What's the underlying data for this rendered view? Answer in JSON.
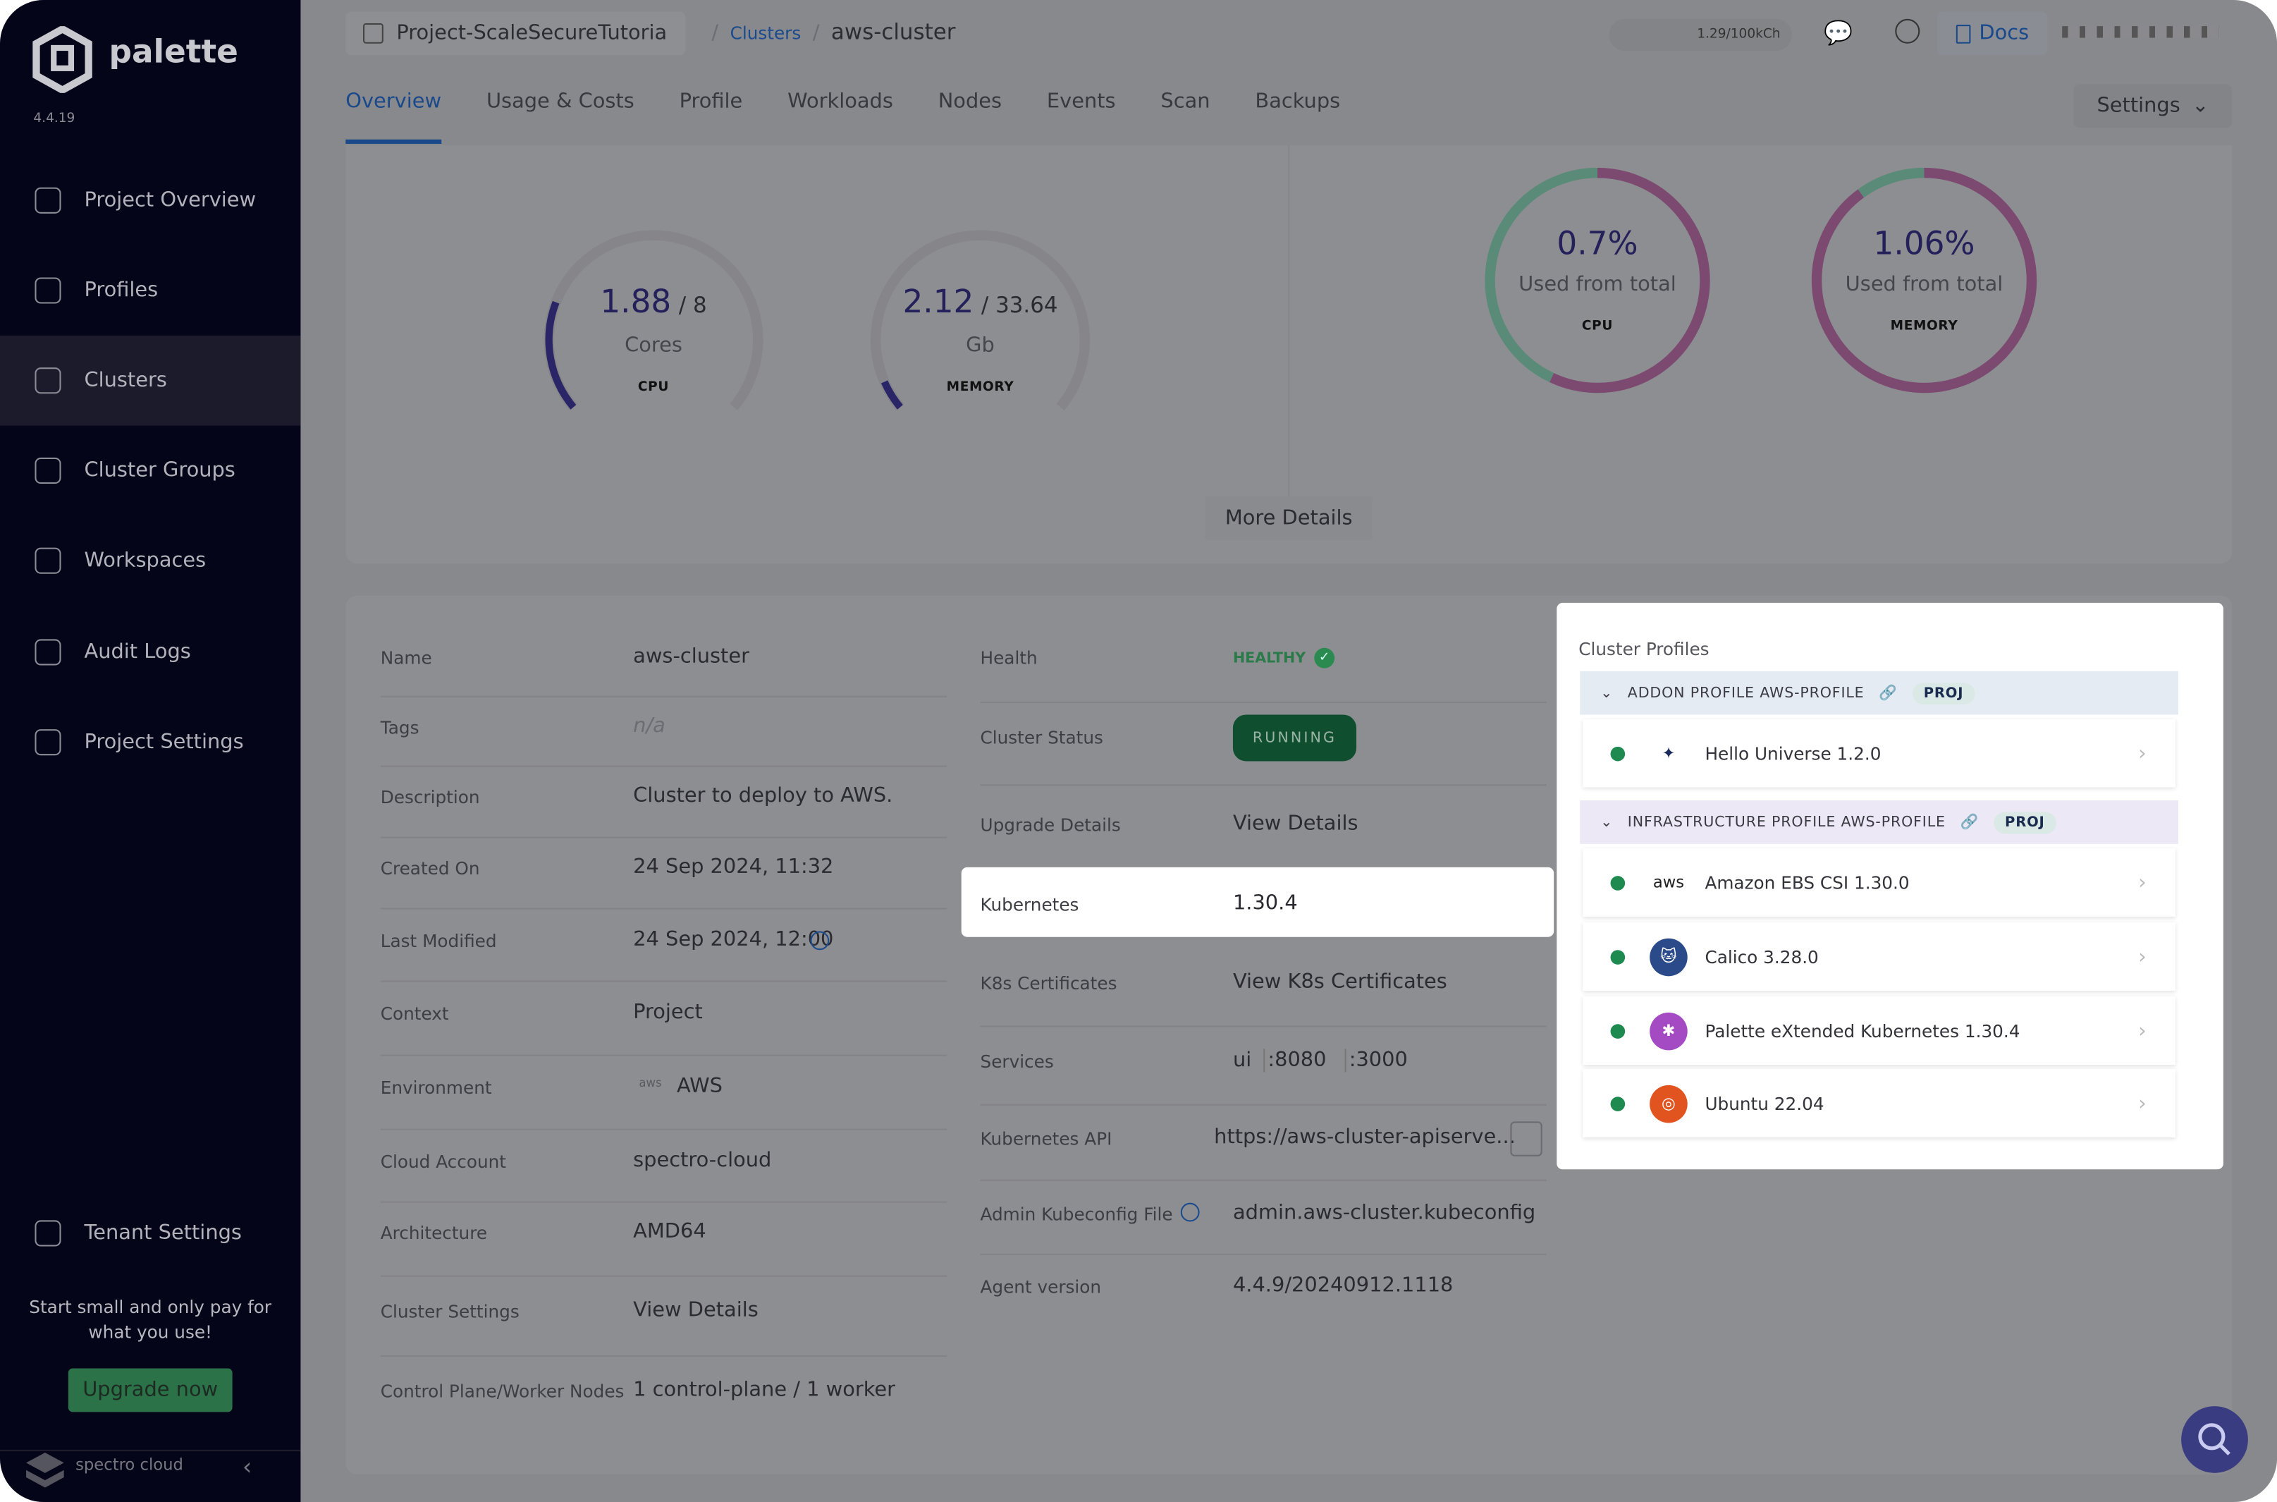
{
  "sidebar": {
    "brand": "palette",
    "version": "4.4.19",
    "items": [
      {
        "label": "Project Overview",
        "icon": "chart-icon"
      },
      {
        "label": "Profiles",
        "icon": "layers-icon"
      },
      {
        "label": "Clusters",
        "icon": "clusters-icon",
        "active": true
      },
      {
        "label": "Cluster Groups",
        "icon": "cluster-groups-icon"
      },
      {
        "label": "Workspaces",
        "icon": "workspaces-icon"
      },
      {
        "label": "Audit Logs",
        "icon": "audit-logs-icon"
      },
      {
        "label": "Project Settings",
        "icon": "gear-icon"
      }
    ],
    "tenant_settings": "Tenant Settings",
    "promo": "Start small and only pay for what you use!",
    "upgrade": "Upgrade now",
    "footer_brand": "spectro cloud"
  },
  "header": {
    "project": "Project-ScaleSecureTutoria",
    "crumb_clusters": "Clusters",
    "crumb_current": "aws-cluster",
    "usage": "1.29/100kCh",
    "docs": "Docs"
  },
  "tabs": [
    "Overview",
    "Usage & Costs",
    "Profile",
    "Workloads",
    "Nodes",
    "Events",
    "Scan",
    "Backups"
  ],
  "settings_label": "Settings",
  "usage": {
    "cpu": {
      "value": "1.88",
      "total": "/ 8",
      "used": 1.88,
      "max": 8,
      "unit": "Cores",
      "label": "CPU"
    },
    "memory": {
      "value": "2.12",
      "total": "/ 33.64",
      "used": 2.12,
      "max": 33.64,
      "unit": "Gb",
      "label": "MEMORY"
    },
    "cpu_pct": {
      "value": "0.7%",
      "caption": "Used from total",
      "label": "CPU"
    },
    "mem_pct": {
      "value": "1.06%",
      "caption": "Used from total",
      "label": "MEMORY"
    },
    "more_details": "More Details"
  },
  "details_left": [
    {
      "label": "Name",
      "value": "aws-cluster"
    },
    {
      "label": "Tags",
      "value": "n/a"
    },
    {
      "label": "Description",
      "value": "Cluster to deploy to AWS."
    },
    {
      "label": "Created On",
      "value": "24 Sep 2024, 11:32"
    },
    {
      "label": "Last Modified",
      "value": "24 Sep 2024, 12:00"
    },
    {
      "label": "Context",
      "value": "Project"
    },
    {
      "label": "Environment",
      "value": "AWS"
    },
    {
      "label": "Cloud Account",
      "value": "spectro-cloud"
    },
    {
      "label": "Architecture",
      "value": "AMD64"
    },
    {
      "label": "Cluster Settings",
      "value": "View Details"
    },
    {
      "label": "Control Plane/Worker Nodes",
      "value": "1 control-plane / 1 worker"
    }
  ],
  "details_mid": [
    {
      "label": "Health",
      "value": "HEALTHY"
    },
    {
      "label": "Cluster Status",
      "value": "RUNNING"
    },
    {
      "label": "Upgrade Details",
      "value": "View Details"
    },
    {
      "label": "Kubernetes",
      "value": "1.30.4"
    },
    {
      "label": "K8s Certificates",
      "value": "View K8s Certificates"
    },
    {
      "label": "Services",
      "value": "ui",
      "ports": [
        ":8080",
        ":3000"
      ]
    },
    {
      "label": "Kubernetes API",
      "value": "https://aws-cluster-apiserve..."
    },
    {
      "label": "Admin Kubeconfig File",
      "value": "admin.aws-cluster.kubeconfig"
    },
    {
      "label": "Agent version",
      "value": "4.4.9/20240912.1118"
    }
  ],
  "cluster_profiles": {
    "title": "Cluster Profiles",
    "addon_header": "ADDON PROFILE AWS-PROFILE",
    "infra_header": "INFRASTRUCTURE PROFILE AWS-PROFILE",
    "scope": "PROJ",
    "addon_items": [
      {
        "name": "Hello Universe 1.2.0",
        "icon": "hello-universe-icon"
      }
    ],
    "infra_items": [
      {
        "name": "Amazon EBS CSI 1.30.0",
        "icon": "aws-icon"
      },
      {
        "name": "Calico 3.28.0",
        "icon": "calico-icon"
      },
      {
        "name": "Palette eXtended Kubernetes 1.30.4",
        "icon": "kubernetes-icon"
      },
      {
        "name": "Ubuntu 22.04",
        "icon": "ubuntu-icon"
      }
    ]
  },
  "colors": {
    "accent": "#19498b",
    "healthy": "#1f8a50",
    "gauge": "#2a2566",
    "ring_free": "#5a8a78",
    "ring_used": "#7c4a70"
  }
}
